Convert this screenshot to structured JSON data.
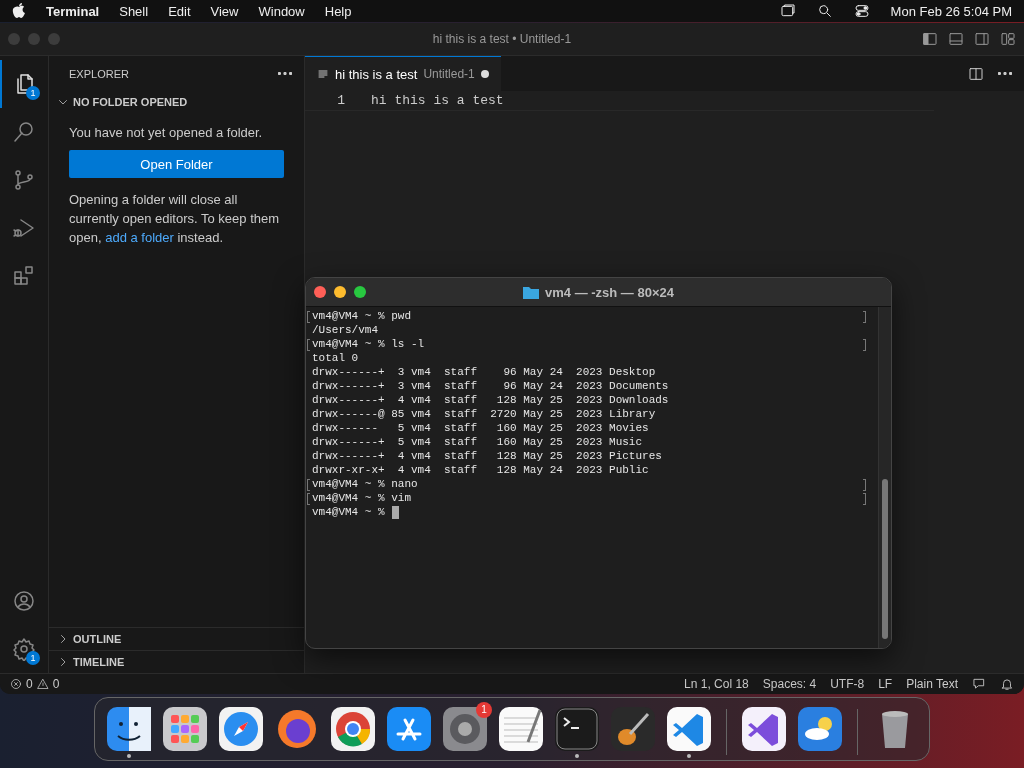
{
  "menu_bar": {
    "app": "Terminal",
    "items": [
      "Shell",
      "Edit",
      "View",
      "Window",
      "Help"
    ],
    "clock": "Mon Feb 26  5:04 PM"
  },
  "editor_window": {
    "title": "hi this is a test • Untitled-1",
    "activity_bar": [
      {
        "kind": "files",
        "selected": true,
        "badge": "1"
      },
      {
        "kind": "search",
        "selected": false
      },
      {
        "kind": "source-control",
        "selected": false
      },
      {
        "kind": "run-debug",
        "selected": false
      },
      {
        "kind": "extensions",
        "selected": false
      }
    ],
    "activity_bar_bottom": [
      {
        "kind": "account"
      },
      {
        "kind": "settings",
        "badge": "1"
      }
    ],
    "sidebar": {
      "title": "EXPLORER",
      "section": "NO FOLDER OPENED",
      "message": "You have not yet opened a folder.",
      "button": "Open Folder",
      "note": "Opening a folder will close all currently open editors. To keep them open,",
      "note_link": "add a folder",
      "note_end": "instead.",
      "collapsed_sections": [
        "OUTLINE",
        "TIMELINE"
      ]
    },
    "tabs": [
      {
        "label": "hi this is a test",
        "description": "Untitled-1",
        "modified": true,
        "selected": true
      }
    ],
    "lines": [
      {
        "number": "1",
        "text": "hi this is a test"
      }
    ],
    "status_bar": {
      "errors": "0",
      "warnings": "0",
      "items": [
        "Ln 1, Col 18",
        "Spaces: 4",
        "UTF-8",
        "LF",
        "Plain Text"
      ]
    }
  },
  "terminal_window": {
    "title": "vm4 — -zsh — 80×24",
    "lines": [
      {
        "text": "vm4@VM4 ~ % pwd",
        "marked": true
      },
      {
        "text": "/Users/vm4",
        "marked": false
      },
      {
        "text": "vm4@VM4 ~ % ls -l",
        "marked": true
      },
      {
        "text": "total 0",
        "marked": false
      },
      {
        "text": "drwx------+  3 vm4  staff    96 May 24  2023 Desktop",
        "marked": false
      },
      {
        "text": "drwx------+  3 vm4  staff    96 May 24  2023 Documents",
        "marked": false
      },
      {
        "text": "drwx------+  4 vm4  staff   128 May 25  2023 Downloads",
        "marked": false
      },
      {
        "text": "drwx------@ 85 vm4  staff  2720 May 25  2023 Library",
        "marked": false
      },
      {
        "text": "drwx------   5 vm4  staff   160 May 25  2023 Movies",
        "marked": false
      },
      {
        "text": "drwx------+  5 vm4  staff   160 May 25  2023 Music",
        "marked": false
      },
      {
        "text": "drwx------+  4 vm4  staff   128 May 25  2023 Pictures",
        "marked": false
      },
      {
        "text": "drwxr-xr-x+  4 vm4  staff   128 May 24  2023 Public",
        "marked": false
      },
      {
        "text": "vm4@VM4 ~ % nano",
        "marked": true
      },
      {
        "text": "vm4@VM4 ~ % vim",
        "marked": true
      },
      {
        "text": "vm4@VM4 ~ %",
        "marked": false,
        "cursor": true
      }
    ]
  },
  "dock": [
    {
      "kind": "finder",
      "running": true
    },
    {
      "kind": "launchpad",
      "running": false
    },
    {
      "kind": "safari",
      "running": false
    },
    {
      "kind": "firefox",
      "running": false
    },
    {
      "kind": "chrome",
      "running": false
    },
    {
      "kind": "app-store",
      "running": false
    },
    {
      "kind": "settings",
      "running": false,
      "badge": "1"
    },
    {
      "kind": "text-edit",
      "running": false
    },
    {
      "kind": "terminal",
      "running": true
    },
    {
      "kind": "guitar",
      "running": false
    },
    {
      "kind": "vscode",
      "running": true
    },
    {
      "kind": "separator"
    },
    {
      "kind": "visual-studio",
      "running": false
    },
    {
      "kind": "weather",
      "running": false
    },
    {
      "kind": "separator"
    },
    {
      "kind": "trash",
      "running": false
    }
  ]
}
